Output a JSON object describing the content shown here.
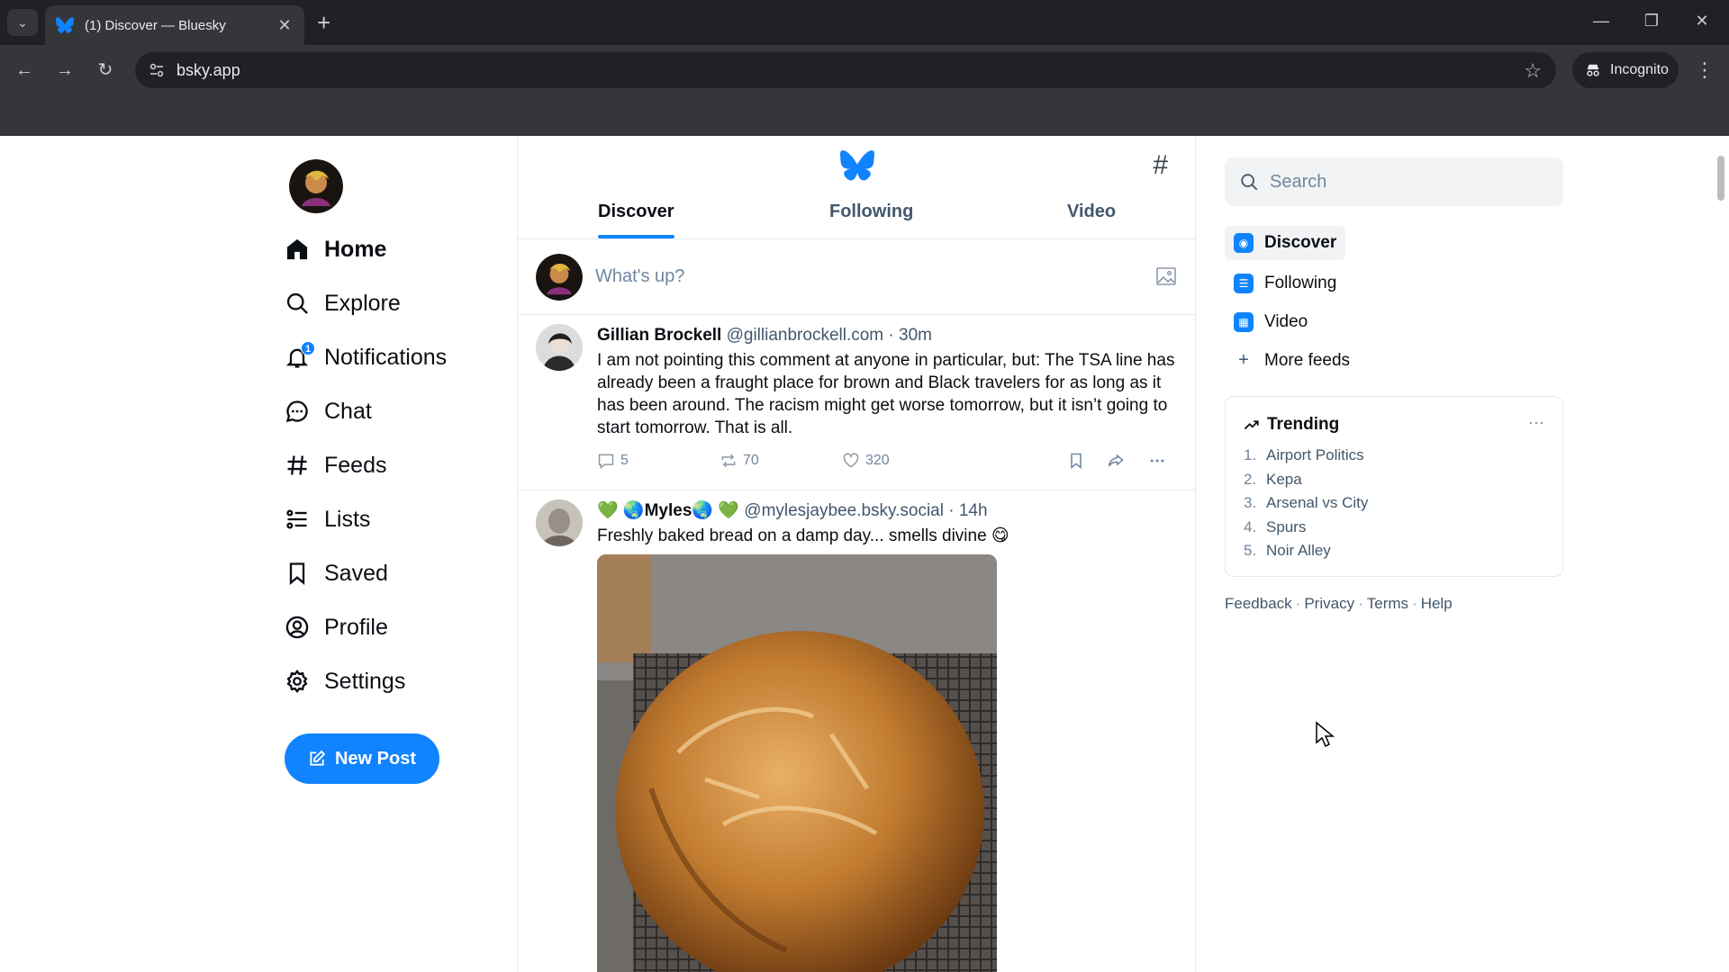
{
  "browser": {
    "tab_title": "(1) Discover — Bluesky",
    "url": "bsky.app",
    "incognito_label": "Incognito"
  },
  "nav": {
    "items": [
      {
        "label": "Home",
        "icon": "home-icon"
      },
      {
        "label": "Explore",
        "icon": "search-icon"
      },
      {
        "label": "Notifications",
        "icon": "bell-icon",
        "badge": "1"
      },
      {
        "label": "Chat",
        "icon": "chat-icon"
      },
      {
        "label": "Feeds",
        "icon": "hash-icon"
      },
      {
        "label": "Lists",
        "icon": "list-icon"
      },
      {
        "label": "Saved",
        "icon": "bookmark-icon"
      },
      {
        "label": "Profile",
        "icon": "profile-icon"
      },
      {
        "label": "Settings",
        "icon": "gear-icon"
      }
    ],
    "new_post_label": "New Post"
  },
  "feed": {
    "tabs": [
      "Discover",
      "Following",
      "Video"
    ],
    "composer_placeholder": "What's up?",
    "posts": [
      {
        "name": "Gillian Brockell",
        "handle": "@gillianbrockell.com",
        "time": "30m",
        "text": "I am not pointing this comment at anyone in particular, but: The TSA line has already been a fraught place for brown and Black travelers for as long as it has been around. The racism might get worse tomorrow, but it isn’t going to start tomorrow. That is all.",
        "replies": "5",
        "reposts": "70",
        "likes": "320"
      },
      {
        "name": "💚 🌏Myles🌏 💚",
        "handle": "@mylesjaybee.bsky.social",
        "time": "14h",
        "text": "Freshly baked bread on a damp day... smells divine 😋"
      }
    ]
  },
  "right": {
    "search_placeholder": "Search",
    "feeds": [
      {
        "label": "Discover"
      },
      {
        "label": "Following"
      },
      {
        "label": "Video"
      }
    ],
    "more_feeds_label": "More feeds",
    "trending_title": "Trending",
    "trending": [
      {
        "num": "1.",
        "label": "Airport Politics"
      },
      {
        "num": "2.",
        "label": "Kepa"
      },
      {
        "num": "3.",
        "label": "Arsenal vs City"
      },
      {
        "num": "4.",
        "label": "Spurs"
      },
      {
        "num": "5.",
        "label": "Noir Alley"
      }
    ],
    "footer": [
      "Feedback",
      "Privacy",
      "Terms",
      "Help"
    ]
  },
  "colors": {
    "accent": "#1083fe",
    "text_secondary": "#42576c",
    "border": "#e6e9ed"
  }
}
